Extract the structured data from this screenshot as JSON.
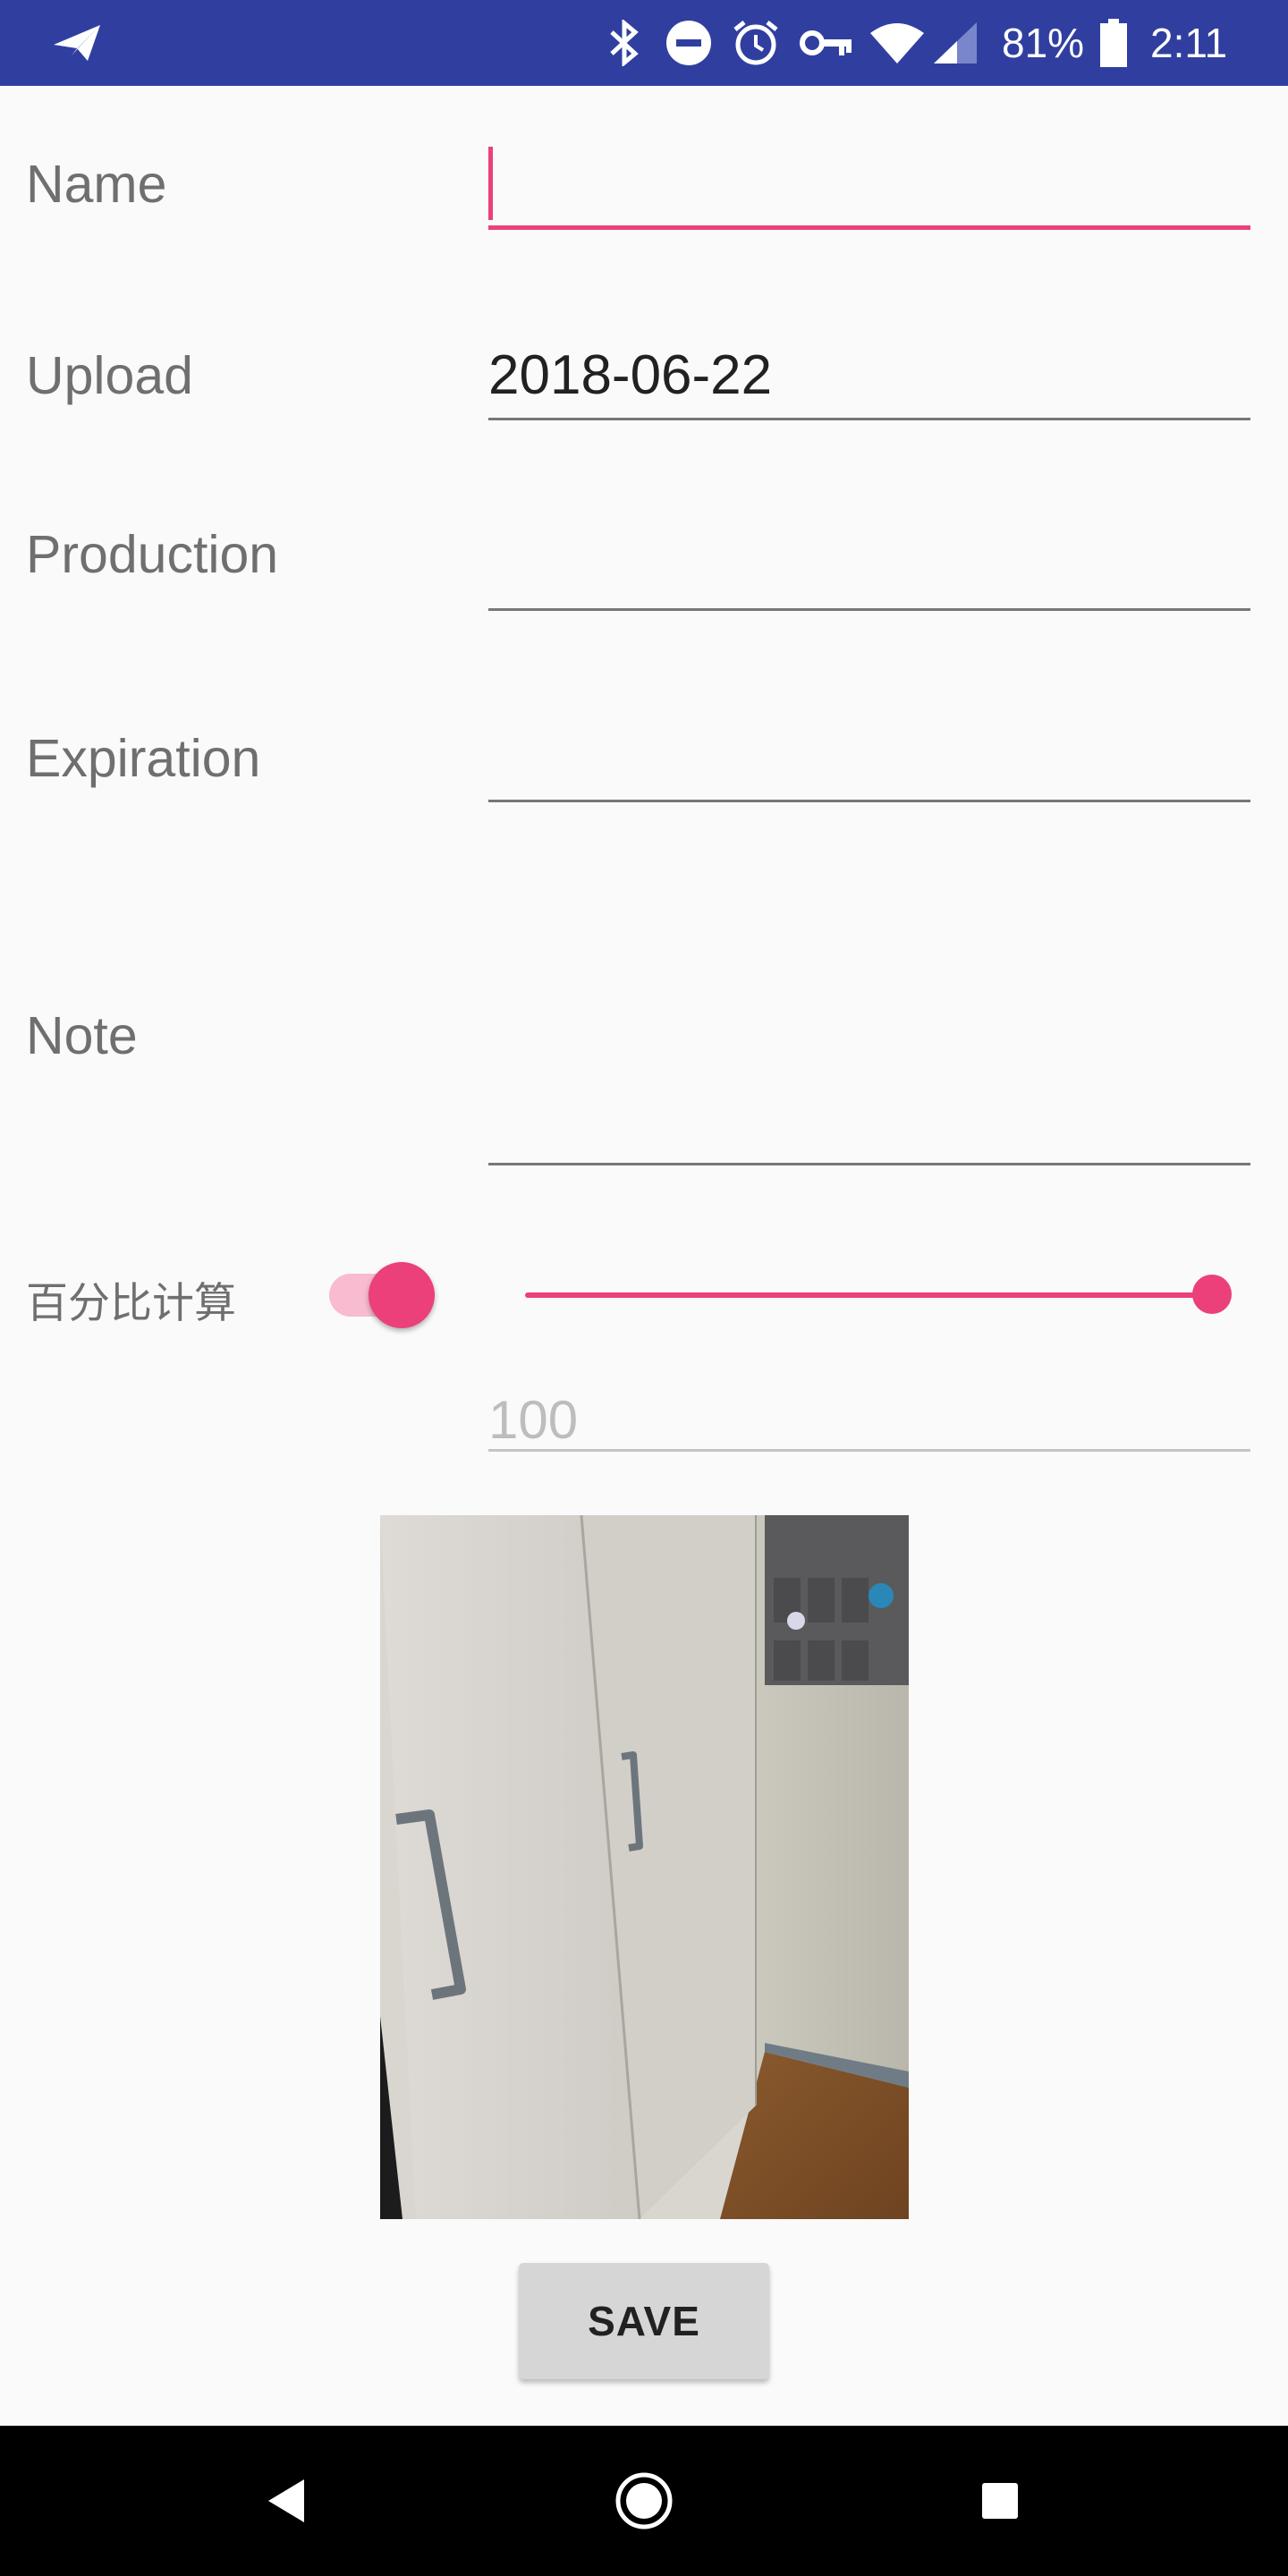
{
  "status_bar": {
    "background": "#303f9f",
    "battery": "81%",
    "time": "2:11",
    "icons": [
      "send-icon",
      "bluetooth-icon",
      "do-not-disturb-icon",
      "alarm-icon",
      "vpn-key-icon",
      "wifi-icon",
      "cellular-signal-icon",
      "battery-icon"
    ]
  },
  "form": {
    "name": {
      "label": "Name",
      "value": ""
    },
    "upload": {
      "label": "Upload",
      "value": "2018-06-22"
    },
    "production": {
      "label": "Production",
      "value": ""
    },
    "expiration": {
      "label": "Expiration",
      "value": ""
    },
    "note": {
      "label": "Note",
      "value": ""
    },
    "percent": {
      "label": "百分比计算",
      "switch_on": true,
      "slider_fraction": 1.0,
      "value": "100"
    }
  },
  "photo": {
    "description_icon": "photo-wardrobe-image"
  },
  "save_label": "SAVE",
  "accent_color": "#ec407a",
  "nav_bar": {
    "icons": [
      "back-icon",
      "home-icon",
      "recents-icon"
    ]
  }
}
